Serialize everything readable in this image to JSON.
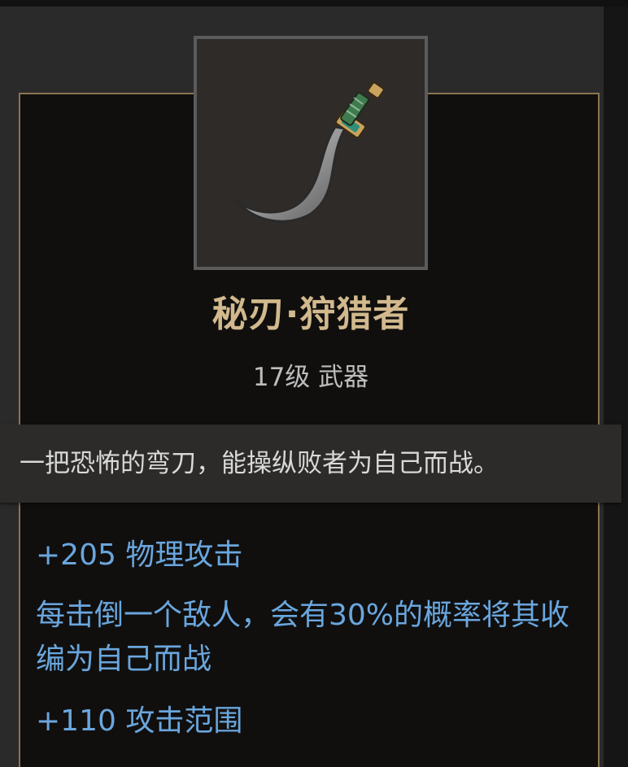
{
  "item": {
    "icon": "curved-blade-icon",
    "name": "秘刃·狩猎者",
    "level_type": "17级 武器",
    "description": "一把恐怖的弯刀，能操纵败者为自己而战。"
  },
  "stats": [
    {
      "text": "+205 物理攻击"
    },
    {
      "text": "每击倒一个敌人，会有30%的概率将其收编为自己而战"
    },
    {
      "text": "+110 攻击范围"
    }
  ],
  "colors": {
    "name": "#d2b98d",
    "stat": "#6aa6dd",
    "border": "#8b7450",
    "description": "#d9d9d9"
  }
}
